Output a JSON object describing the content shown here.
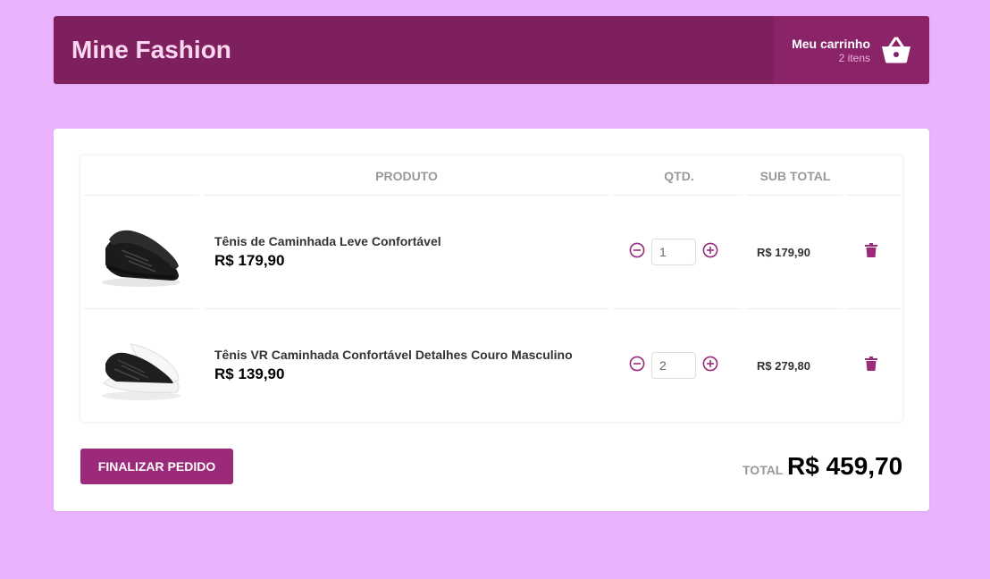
{
  "header": {
    "brand": "Mine Fashion",
    "cart_title": "Meu carrinho",
    "cart_count": "2 itens",
    "cart_icon": "basket-icon"
  },
  "colors": {
    "background": "#ebb3fd",
    "header": "#7e1f5e",
    "cart_box": "#8a2368",
    "accent": "#9b2a7a"
  },
  "table": {
    "columns": [
      "PRODUTO",
      "QTD.",
      "SUB TOTAL"
    ],
    "items": [
      {
        "name": "Tênis de Caminhada Leve Confortável",
        "price": "R$ 179,90",
        "quantity": "1",
        "subtotal": "R$ 179,90",
        "image": "black-sneaker"
      },
      {
        "name": "Tênis VR Caminhada Confortável Detalhes Couro Masculino",
        "price": "R$ 139,90",
        "quantity": "2",
        "subtotal": "R$ 279,80",
        "image": "black-white-sneaker"
      }
    ]
  },
  "footer": {
    "finalize_label": "FINALIZAR PEDIDO",
    "total_label": "TOTAL",
    "total_value": "R$ 459,70"
  }
}
